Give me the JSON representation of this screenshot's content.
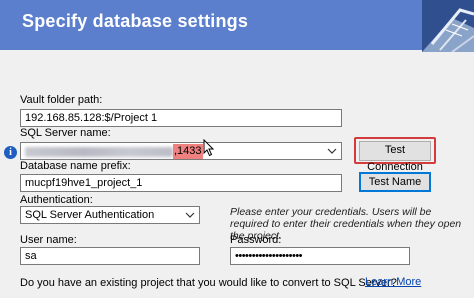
{
  "header": {
    "title": "Specify database settings"
  },
  "vault": {
    "label": "Vault folder path:",
    "value": "192.168.85.128:$/Project 1"
  },
  "sql_server": {
    "label": "SQL Server name:",
    "value_suffix": ",1433",
    "test_connection_label": "Test Connection"
  },
  "db_prefix": {
    "label": "Database name prefix:",
    "value": "mucpf19hve1_project_1",
    "test_name_label": "Test Name"
  },
  "auth": {
    "label": "Authentication:",
    "value": "SQL Server Authentication",
    "note": "Please enter your credentials. Users will be required to enter their credentials when they open the project."
  },
  "username": {
    "label": "User name:",
    "value": "sa"
  },
  "password": {
    "label": "Password:",
    "value": "••••••••••••••••••••"
  },
  "convert": {
    "question": "Do you have an existing project that you would like to convert to SQL Server?",
    "learn_more": "Learn More"
  },
  "icons": [
    "info-icon",
    "chevron-down-icon",
    "mouse-cursor-icon"
  ],
  "colors": {
    "header_bg": "#5b7fcd",
    "highlight_border": "#d33c3c",
    "port_highlight": "#ef8080",
    "focus_border": "#0078d7",
    "link": "#0645ad"
  }
}
